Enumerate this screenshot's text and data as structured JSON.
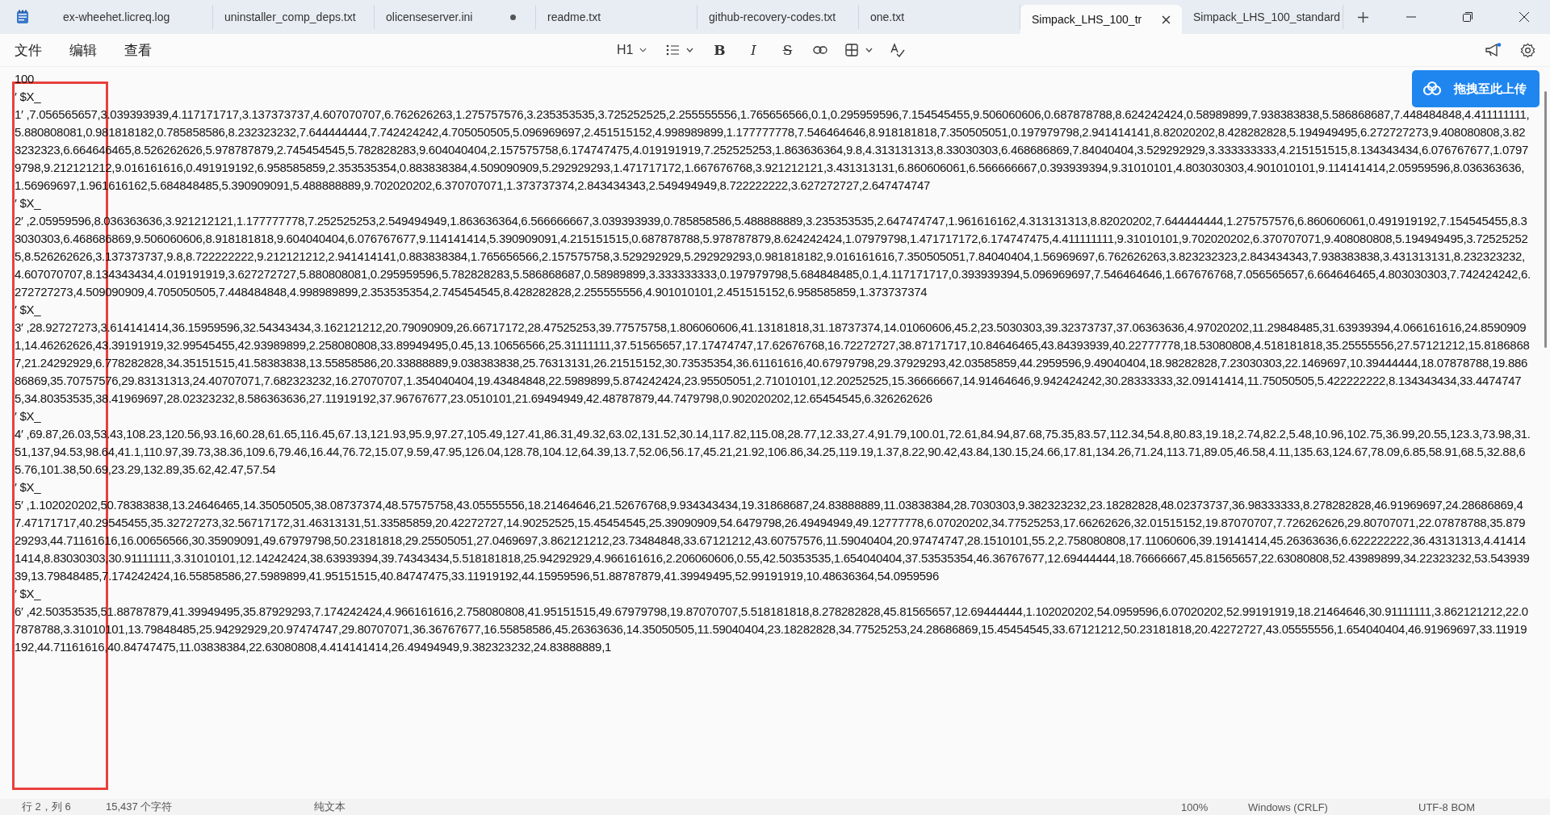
{
  "window": {
    "tabs": [
      {
        "label": "ex-wheehet.licreq.log",
        "selected": false,
        "modified": false
      },
      {
        "label": "uninstaller_comp_deps.txt",
        "selected": false,
        "modified": false
      },
      {
        "label": "olicenseserver.ini",
        "selected": false,
        "modified": true
      },
      {
        "label": "readme.txt",
        "selected": false,
        "modified": false
      },
      {
        "label": "github-recovery-codes.txt",
        "selected": false,
        "modified": false
      },
      {
        "label": "one.txt",
        "selected": false,
        "modified": false
      },
      {
        "label": "Simpack_LHS_100_tr",
        "selected": true,
        "modified": false
      },
      {
        "label": "Simpack_LHS_100_standard",
        "selected": false,
        "modified": false
      }
    ]
  },
  "menu": [
    "文件",
    "编辑",
    "查看"
  ],
  "toolbar": {
    "heading": "H1",
    "format_buttons": [
      "B",
      "I",
      "S"
    ]
  },
  "upload_button": {
    "label": "拖拽至此上传"
  },
  "document": {
    "lines": [
      "100",
      "′ $X_",
      "1′ ,7.056565657,3.039393939,4.117171717,3.137373737,4.607070707,6.762626263,1.275757576,3.235353535,3.725252525,2.255555556,1.765656566,0.1,0.295959596,7.154545455,9.506060606,0.687878788,8.624242424,0.58989899,7.938383838,5.586868687,7.448484848,4.411111111,5.880808081,0.981818182,0.785858586,8.232323232,7.644444444,7.742424242,4.705050505,5.096969697,2.451515152,4.998989899,1.177777778,7.546464646,8.918181818,7.350505051,0.197979798,2.941414141,8.82020202,8.428282828,5.194949495,6.272727273,9.408080808,3.823232323,6.664646465,8.526262626,5.978787879,2.745454545,5.782828283,9.604040404,2.157575758,6.174747475,4.019191919,7.252525253,1.863636364,9.8,4.313131313,8.33030303,6.468686869,7.84040404,3.529292929,3.333333333,4.215151515,8.134343434,6.076767677,1.07979798,9.212121212,9.016161616,0.491919192,6.958585859,2.353535354,0.883838384,4.509090909,5.292929293,1.471717172,1.667676768,3.921212121,3.431313131,6.860606061,6.566666667,0.393939394,9.31010101,4.803030303,4.901010101,9.114141414,2.05959596,8.036363636,1.56969697,1.961616162,5.684848485,5.390909091,5.488888889,9.702020202,6.370707071,1.373737374,2.843434343,2.549494949,8.722222222,3.627272727,2.647474747",
      "′ $X_",
      "2′ ,2.05959596,8.036363636,3.921212121,1.177777778,7.252525253,2.549494949,1.863636364,6.566666667,3.039393939,0.785858586,5.488888889,3.235353535,2.647474747,1.961616162,4.313131313,8.82020202,7.644444444,1.275757576,6.860606061,0.491919192,7.154545455,8.33030303,6.468686869,9.506060606,8.918181818,9.604040404,6.076767677,9.114141414,5.390909091,4.215151515,0.687878788,5.978787879,8.624242424,1.07979798,1.471717172,6.174747475,4.411111111,9.31010101,9.702020202,6.370707071,9.408080808,5.194949495,3.725252525,8.526262626,3.137373737,9.8,8.722222222,9.212121212,2.941414141,0.883838384,1.765656566,2.157575758,3.529292929,5.292929293,0.981818182,9.016161616,7.350505051,7.84040404,1.56969697,6.762626263,3.823232323,2.843434343,7.938383838,3.431313131,8.232323232,4.607070707,8.134343434,4.019191919,3.627272727,5.880808081,0.295959596,5.782828283,5.586868687,0.58989899,3.333333333,0.197979798,5.684848485,0.1,4.117171717,0.393939394,5.096969697,7.546464646,1.667676768,7.056565657,6.664646465,4.803030303,7.742424242,6.272727273,4.509090909,4.705050505,7.448484848,4.998989899,2.353535354,2.745454545,8.428282828,2.255555556,4.901010101,2.451515152,6.958585859,1.373737374",
      "′ $X_",
      "3′ ,28.92727273,3.614141414,36.15959596,32.54343434,3.162121212,20.79090909,26.66717172,28.47525253,39.77575758,1.806060606,41.13181818,31.18737374,14.01060606,45.2,23.5030303,39.32373737,37.06363636,4.97020202,11.29848485,31.63939394,4.066161616,24.85909091,14.46262626,43.39191919,32.99545455,42.93989899,2.258080808,33.89949495,0.45,13.10656566,25.31111111,37.51565657,17.17474747,17.62676768,16.72272727,38.87171717,10.84646465,43.84393939,40.22777778,18.53080808,4.518181818,35.25555556,27.57121212,15.81868687,21.24292929,6.778282828,34.35151515,41.58383838,13.55858586,20.33888889,9.038383838,25.76313131,26.21515152,30.73535354,36.61161616,40.67979798,29.37929293,42.03585859,44.2959596,9.49040404,18.98282828,7.23030303,22.1469697,10.39444444,18.07878788,19.88686869,35.70757576,29.83131313,24.40707071,7.682323232,16.27070707,1.354040404,19.43484848,22.5989899,5.874242424,23.95505051,2.71010101,12.20252525,15.36666667,14.91464646,9.942424242,30.28333333,32.09141414,11.75050505,5.422222222,8.134343434,33.44747475,34.80353535,38.41969697,28.02323232,8.586363636,27.11919192,37.96767677,23.0510101,21.69494949,42.48787879,44.7479798,0.902020202,12.65454545,6.326262626",
      "′ $X_",
      "4′ ,69.87,26.03,53.43,108.23,120.56,93.16,60.28,61.65,116.45,67.13,121.93,95.9,97.27,105.49,127.41,86.31,49.32,63.02,131.52,30.14,117.82,115.08,28.77,12.33,27.4,91.79,100.01,72.61,84.94,87.68,75.35,83.57,112.34,54.8,80.83,19.18,2.74,82.2,5.48,10.96,102.75,36.99,20.55,123.3,73.98,31.51,137,94.53,98.64,41.1,110.97,39.73,38.36,109.6,79.46,16.44,76.72,15.07,9.59,47.95,126.04,128.78,104.12,64.39,13.7,52.06,56.17,45.21,21.92,106.86,34.25,119.19,1.37,8.22,90.42,43.84,130.15,24.66,17.81,134.26,71.24,113.71,89.05,46.58,4.11,135.63,124.67,78.09,6.85,58.91,68.5,32.88,65.76,101.38,50.69,23.29,132.89,35.62,42.47,57.54",
      "′ $X_",
      "5′ ,1.102020202,50.78383838,13.24646465,14.35050505,38.08737374,48.57575758,43.05555556,18.21464646,21.52676768,9.934343434,19.31868687,24.83888889,11.03838384,28.7030303,9.382323232,23.18282828,48.02373737,36.98333333,8.278282828,46.91969697,24.28686869,47.47171717,40.29545455,35.32727273,32.56717172,31.46313131,51.33585859,20.42272727,14.90252525,15.45454545,25.39090909,54.6479798,26.49494949,49.12777778,6.07020202,34.77525253,17.66262626,32.01515152,19.87070707,7.726262626,29.80707071,22.07878788,35.87929293,44.71161616,16.00656566,30.35909091,49.67979798,50.23181818,29.25505051,27.0469697,3.862121212,23.73484848,33.67121212,43.60757576,11.59040404,20.97474747,28.1510101,55.2,2.758080808,17.11060606,39.19141414,45.26363636,6.622222222,36.43131313,4.414141414,8.83030303,30.91111111,3.31010101,12.14242424,38.63939394,39.74343434,5.518181818,25.94292929,4.966161616,2.206060606,0.55,42.50353535,1.654040404,37.53535354,46.36767677,12.69444444,18.76666667,45.81565657,22.63080808,52.43989899,34.22323232,53.54393939,13.79848485,7.174242424,16.55858586,27.5989899,41.95151515,40.84747475,33.11919192,44.15959596,51.88787879,41.39949495,52.99191919,10.48636364,54.0959596",
      "′ $X_",
      "6′ ,42.50353535,51.88787879,41.39949495,35.87929293,7.174242424,4.966161616,2.758080808,41.95151515,49.67979798,19.87070707,5.518181818,8.278282828,45.81565657,12.69444444,1.102020202,54.0959596,6.07020202,52.99191919,18.21464646,30.91111111,3.862121212,22.07878788,3.31010101,13.79848485,25.94292929,20.97474747,29.80707071,36.36767677,16.55858586,45.26363636,14.35050505,11.59040404,23.18282828,34.77525253,24.28686869,15.45454545,33.67121212,50.23181818,20.42272727,43.05555556,1.654040404,46.91969697,33.11919192,44.71161616,40.84747475,11.03838384,22.63080808,4.414141414,26.49494949,9.382323232,24.83888889,1"
    ]
  },
  "status_bar": [
    "行 2，列 6",
    "15,437 个字符",
    "纯文本",
    "100%",
    "Windows (CRLF)",
    "UTF-8 BOM"
  ]
}
